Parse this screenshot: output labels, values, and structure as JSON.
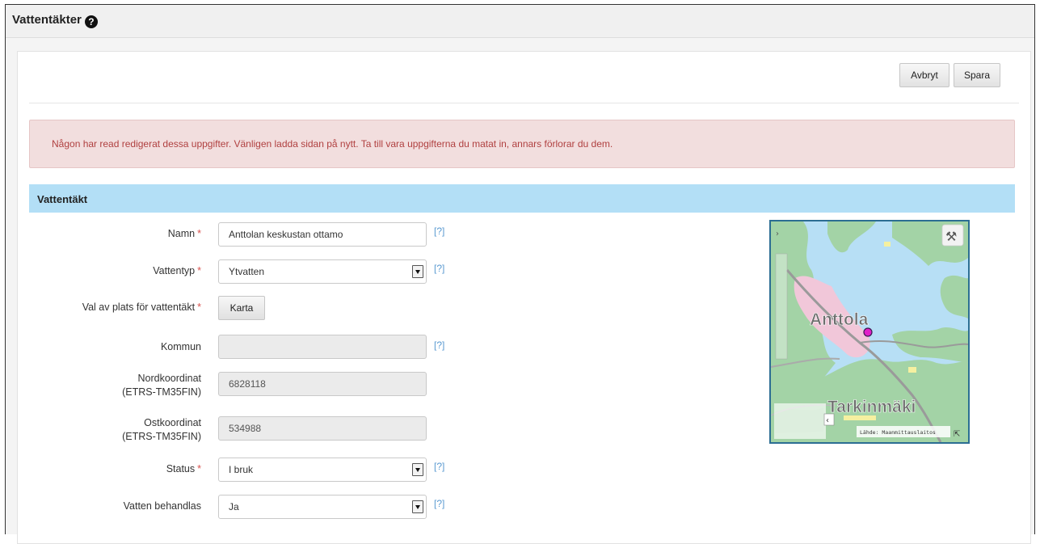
{
  "header": {
    "title": "Vattentäkter",
    "help_icon": "question-circle-icon"
  },
  "toolbar": {
    "cancel_label": "Avbryt",
    "save_label": "Spara"
  },
  "alert": {
    "message": "Någon har read redigerat dessa uppgifter. Vänligen ladda sidan på nytt. Ta till vara uppgifterna du matat in, annars förlorar du dem."
  },
  "section": {
    "title": "Vattentäkt"
  },
  "form": {
    "required_marker": "*",
    "help_link": "[?]",
    "name": {
      "label": "Namn",
      "value": "Anttolan keskustan ottamo"
    },
    "water_type": {
      "label": "Vattentyp",
      "value": "Ytvatten"
    },
    "location": {
      "label": "Val av plats för vattentäkt",
      "button": "Karta"
    },
    "municipality": {
      "label": "Kommun",
      "value": ""
    },
    "north": {
      "label_line1": "Nordkoordinat",
      "label_line2": "(ETRS-TM35FIN)",
      "value": "6828118"
    },
    "east": {
      "label_line1": "Ostkoordinat",
      "label_line2": "(ETRS-TM35FIN)",
      "value": "534988"
    },
    "status": {
      "label": "Status",
      "value": "I bruk"
    },
    "treated": {
      "label": "Vatten behandlas",
      "value": "Ja"
    }
  },
  "map": {
    "place_label_1": "Anttola",
    "place_label_2": "Tarkinmäki",
    "attribution": "Lähde: Maanmittauslaitos",
    "colors": {
      "water": "#b7dff5",
      "land": "#9fd1a3",
      "urban": "#f1c7d9",
      "marker": "#e020c8"
    }
  }
}
